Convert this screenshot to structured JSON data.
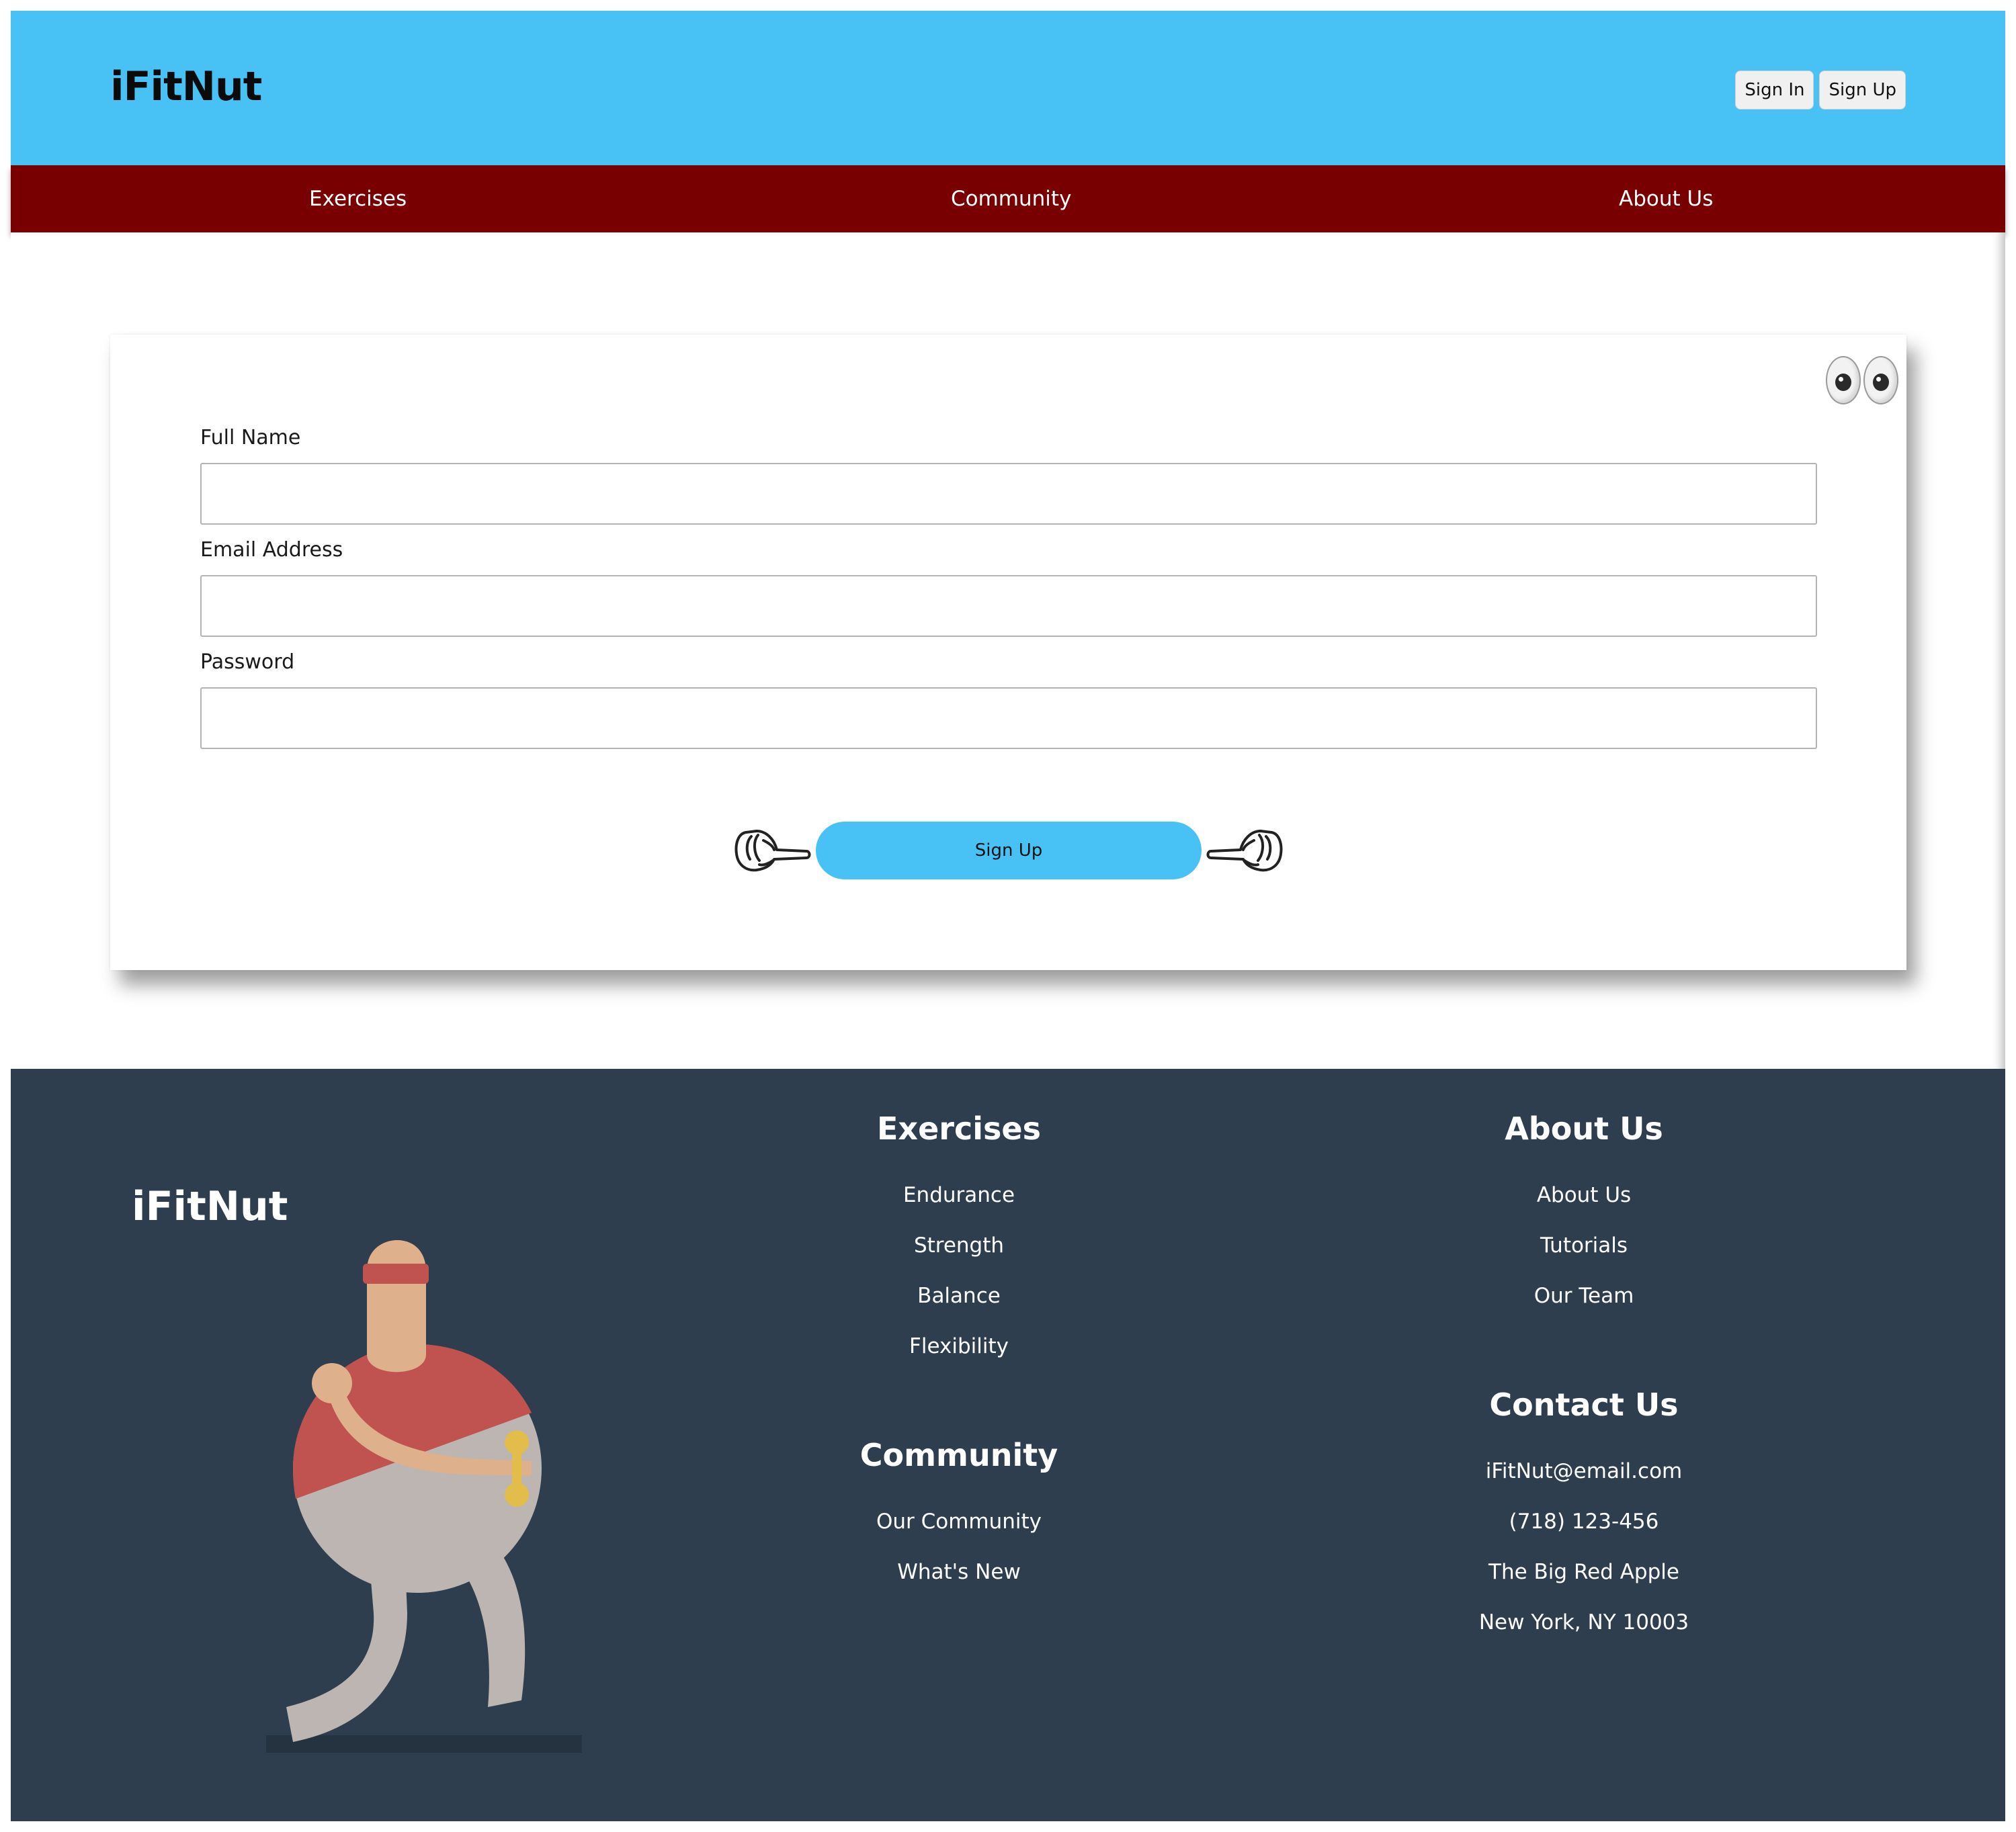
{
  "header": {
    "logo": "iFitNut",
    "sign_in_label": "Sign In",
    "sign_up_label": "Sign Up"
  },
  "nav": {
    "items": [
      {
        "label": "Exercises"
      },
      {
        "label": "Community"
      },
      {
        "label": "About Us"
      }
    ]
  },
  "form": {
    "full_name_label": "Full Name",
    "full_name_value": "",
    "email_label": "Email Address",
    "email_value": "",
    "password_label": "Password",
    "password_value": "",
    "submit_label": "Sign Up"
  },
  "footer": {
    "logo": "iFitNut",
    "exercises": {
      "heading": "Exercises",
      "links": [
        "Endurance",
        "Strength",
        "Balance",
        "Flexibility"
      ]
    },
    "community": {
      "heading": "Community",
      "links": [
        "Our Community",
        "What's New"
      ]
    },
    "about": {
      "heading": "About Us",
      "links": [
        "About Us",
        "Tutorials",
        "Our Team"
      ]
    },
    "contact": {
      "heading": "Contact Us",
      "email": "iFitNut@email.com",
      "phone": "(718) 123-456",
      "address_line1": "The Big Red Apple",
      "address_line2": "New York, NY 10003"
    }
  },
  "colors": {
    "header_bg": "#48c2f5",
    "nav_bg": "#790000",
    "footer_bg": "#2e3e4f",
    "button_accent": "#48c2f5"
  },
  "icons": [
    "eyes-icon",
    "pointing-right-hand-icon",
    "pointing-left-hand-icon",
    "fitness-character-illustration"
  ]
}
